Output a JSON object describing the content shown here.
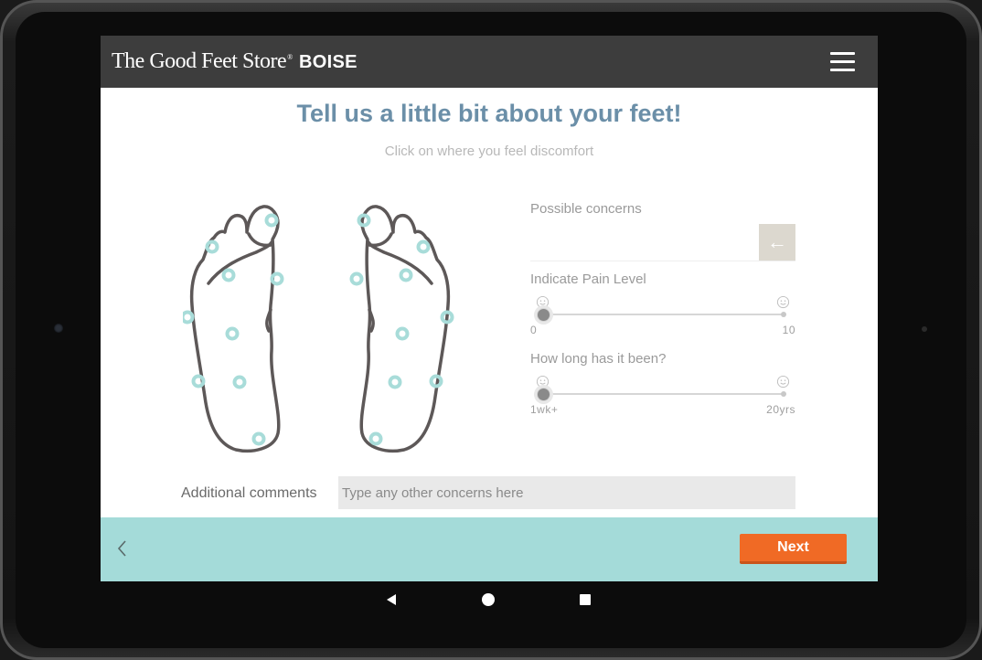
{
  "header": {
    "brand": "The Good Feet Store",
    "brand_mark": "®",
    "store": "BOISE"
  },
  "main": {
    "title": "Tell us a little bit about your feet!",
    "subtitle": "Click on where you feel discomfort"
  },
  "concerns": {
    "label": "Possible concerns",
    "back_icon": "arrow-left-icon"
  },
  "pain": {
    "label": "Indicate Pain Level",
    "min": "0",
    "max": "10",
    "value": 0
  },
  "duration": {
    "label": "How long has it been?",
    "min": "1wk+",
    "max": "20yrs",
    "value": 0
  },
  "comments": {
    "label": "Additional comments",
    "placeholder": "Type any other concerns here",
    "value": ""
  },
  "footer": {
    "next_label": "Next",
    "prev_icon": "chevron-left-icon"
  },
  "colors": {
    "header_bg": "#3d3d3d",
    "title": "#6b8fa8",
    "footer_bg": "#a4dbd9",
    "next_button": "#f06a25",
    "hotspot": "#a8dcd9",
    "foot_outline": "#5d5858"
  }
}
